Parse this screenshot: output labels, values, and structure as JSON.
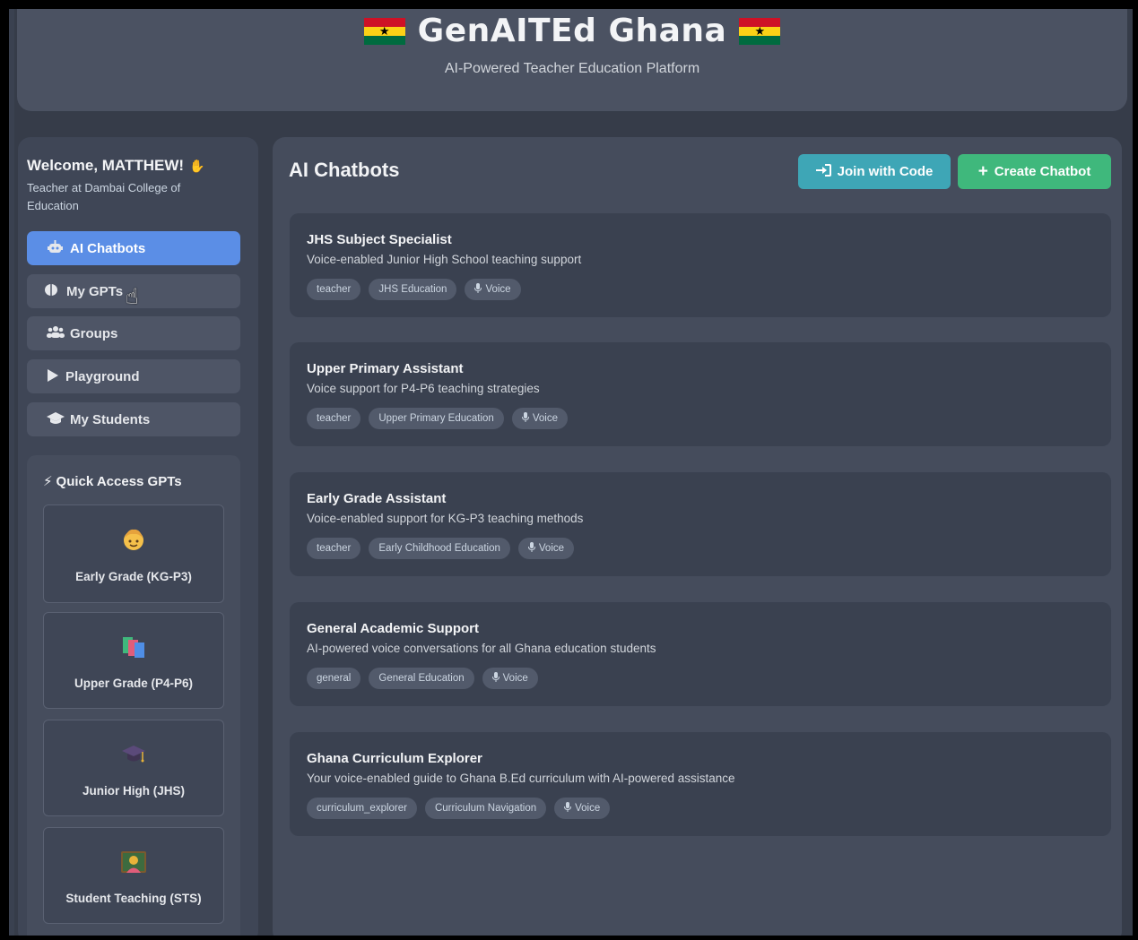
{
  "header": {
    "title": "GenAITEd Ghana",
    "subtitle": "AI-Powered Teacher Education Platform"
  },
  "sidebar": {
    "welcome": "Welcome, MATTHEW!",
    "role": "Teacher at Dambai College of Education",
    "nav": [
      {
        "label": "AI Chatbots",
        "icon": "robot-icon",
        "active": true
      },
      {
        "label": "My GPTs",
        "icon": "brain-icon",
        "active": false
      },
      {
        "label": "Groups",
        "icon": "users-icon",
        "active": false
      },
      {
        "label": "Playground",
        "icon": "play-icon",
        "active": false
      },
      {
        "label": "My Students",
        "icon": "graduation-cap-icon",
        "active": false
      }
    ],
    "quick_access": {
      "title": "Quick Access GPTs",
      "items": [
        {
          "label": "Early Grade (KG-P3)",
          "icon": "child-emoji"
        },
        {
          "label": "Upper Grade (P4-P6)",
          "icon": "books-emoji"
        },
        {
          "label": "Junior High (JHS)",
          "icon": "graduation-cap-emoji"
        },
        {
          "label": "Student Teaching (STS)",
          "icon": "teacher-emoji"
        }
      ]
    }
  },
  "main": {
    "title": "AI Chatbots",
    "join_button": "Join with Code",
    "create_button": "Create Chatbot",
    "chatbots": [
      {
        "title": "JHS Subject Specialist",
        "description": "Voice-enabled Junior High School teaching support",
        "tags": [
          "teacher",
          "JHS Education",
          "Voice"
        ]
      },
      {
        "title": "Upper Primary Assistant",
        "description": "Voice support for P4-P6 teaching strategies",
        "tags": [
          "teacher",
          "Upper Primary Education",
          "Voice"
        ]
      },
      {
        "title": "Early Grade Assistant",
        "description": "Voice-enabled support for KG-P3 teaching methods",
        "tags": [
          "teacher",
          "Early Childhood Education",
          "Voice"
        ]
      },
      {
        "title": "General Academic Support",
        "description": "AI-powered voice conversations for all Ghana education students",
        "tags": [
          "general",
          "General Education",
          "Voice"
        ]
      },
      {
        "title": "Ghana Curriculum Explorer",
        "description": "Your voice-enabled guide to Ghana B.Ed curriculum with AI-powered assistance",
        "tags": [
          "curriculum_explorer",
          "Curriculum Navigation",
          "Voice"
        ]
      }
    ]
  },
  "colors": {
    "primary_active": "#5b8ee6",
    "join_button": "#3ea6b6",
    "create_button": "#3fb87c",
    "background": "#363c49"
  }
}
